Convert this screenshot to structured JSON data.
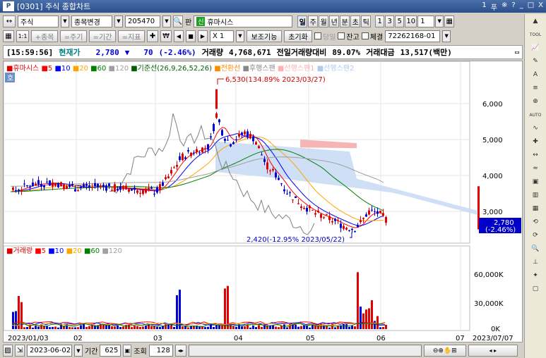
{
  "window": {
    "title": "[0301] 주식 종합차트",
    "controls": [
      "1",
      "푸",
      "※",
      "?",
      "_",
      "□",
      "X"
    ]
  },
  "toolbar1": {
    "market": "주식",
    "mode": "종목변경",
    "code": "205470",
    "pan_label": "판",
    "new_badge": "신",
    "stock_name": "휴마시스",
    "periods": [
      "일",
      "주",
      "월",
      "년",
      "분",
      "초",
      "틱"
    ],
    "active_period": "일",
    "intervals": [
      "1",
      "3",
      "5",
      "10",
      "1"
    ]
  },
  "toolbar2": {
    "items": [
      "1:1",
      "+종목",
      "=주기",
      "=기간",
      "=지표",
      "✚",
      "₩",
      "◀",
      "■",
      "▶",
      "X 1"
    ],
    "aux_button": "보조기능",
    "reset_button": "초기화",
    "check_today": "당일",
    "check_balance": "잔고",
    "check_exec": "체결",
    "account": "72262168-01"
  },
  "quote": {
    "time": "[15:59:56]",
    "label_price": "현재가",
    "price": "2,780",
    "arrow": "▼",
    "change": "70",
    "change_pct": "(-2.46%)",
    "volume_label": "거래량",
    "volume": "4,768,671",
    "prev_vol_label": "전일거래량대비",
    "prev_vol_pct": "89.07%",
    "amount_label": "거래대금",
    "amount": "13,517(백만)"
  },
  "price_panel": {
    "legend": [
      {
        "text": "■휴마시스",
        "color": "#e00000"
      },
      {
        "text": "■5",
        "color": "#ff0000"
      },
      {
        "text": "■10",
        "color": "#0000ff"
      },
      {
        "text": "■20",
        "color": "#ffa500"
      },
      {
        "text": "■60",
        "color": "#008000"
      },
      {
        "text": "■120",
        "color": "#a0a0a0"
      },
      {
        "text": "■기준선(26,9,26,52,26)",
        "color": "#006000"
      },
      {
        "text": "■전환선",
        "color": "#ff8c00"
      },
      {
        "text": "■후행스팬",
        "color": "#888888"
      },
      {
        "text": "■선행스팬1",
        "color": "#ffb0b0"
      },
      {
        "text": "■선행스팬2",
        "color": "#b0c8f0"
      }
    ],
    "y_ticks": [
      "6,000",
      "5,000",
      "4,000",
      "3,000"
    ],
    "high_note": "6,530(134.89% 2023/03/27)",
    "low_note": "2,420(-12.95% 2023/05/22)",
    "last_price": "2,780",
    "last_pct": "(-2.46%)",
    "badge": "호"
  },
  "volume_panel": {
    "legend": [
      {
        "text": "■거래량",
        "color": "#e00000"
      },
      {
        "text": "■5",
        "color": "#ff0000"
      },
      {
        "text": "■10",
        "color": "#0000ff"
      },
      {
        "text": "■20",
        "color": "#ffa500"
      },
      {
        "text": "■60",
        "color": "#008000"
      },
      {
        "text": "■120",
        "color": "#a0a0a0"
      }
    ],
    "y_ticks": [
      "60,000K",
      "30,000K",
      "0K"
    ]
  },
  "x_axis": {
    "labels": [
      "2023/01/03",
      "02",
      "03",
      "04",
      "05",
      "06",
      "07",
      "2023/07/07"
    ]
  },
  "bottom": {
    "date": "2023-06-02",
    "period_label": "기간",
    "period_value": "625",
    "view_label": "조회",
    "view_value": "128"
  },
  "right_tools": [
    "▲",
    "TOOL",
    "📈",
    "✎",
    "A",
    "≡",
    "⊕",
    "AUTO",
    "∿",
    "✚",
    "↔",
    "≈",
    "▣",
    "▥",
    "▦",
    "⟲",
    "⟳",
    "🔍",
    "⊥",
    "✦",
    "▢"
  ],
  "colors": {
    "up": "#e00000",
    "down": "#0000d8",
    "accent": "#2b4f8c"
  }
}
